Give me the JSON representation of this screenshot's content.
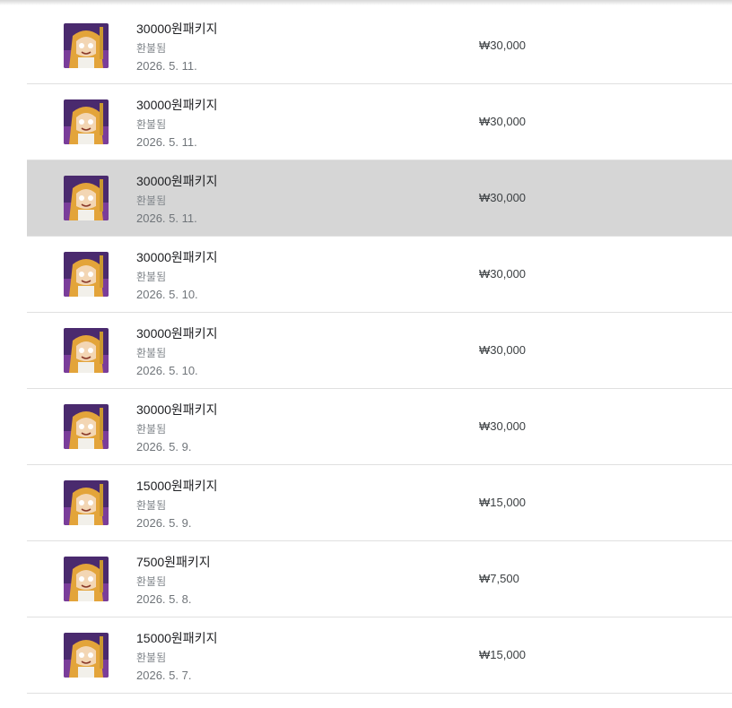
{
  "colors": {
    "selected_row": "#d6d6d6",
    "divider": "#e0e0e0",
    "title": "#202124",
    "secondary": "#80868b"
  },
  "purchases": [
    {
      "title": "30000원패키지",
      "status": "환불됨",
      "date": "2026. 5. 11.",
      "price": "₩30,000",
      "icon": "game-app-icon",
      "selected": false
    },
    {
      "title": "30000원패키지",
      "status": "환불됨",
      "date": "2026. 5. 11.",
      "price": "₩30,000",
      "icon": "game-app-icon",
      "selected": false
    },
    {
      "title": "30000원패키지",
      "status": "환불됨",
      "date": "2026. 5. 11.",
      "price": "₩30,000",
      "icon": "game-app-icon",
      "selected": true
    },
    {
      "title": "30000원패키지",
      "status": "환불됨",
      "date": "2026. 5. 10.",
      "price": "₩30,000",
      "icon": "game-app-icon",
      "selected": false
    },
    {
      "title": "30000원패키지",
      "status": "환불됨",
      "date": "2026. 5. 10.",
      "price": "₩30,000",
      "icon": "game-app-icon",
      "selected": false
    },
    {
      "title": "30000원패키지",
      "status": "환불됨",
      "date": "2026. 5. 9.",
      "price": "₩30,000",
      "icon": "game-app-icon",
      "selected": false
    },
    {
      "title": "15000원패키지",
      "status": "환불됨",
      "date": "2026. 5. 9.",
      "price": "₩15,000",
      "icon": "game-app-icon",
      "selected": false
    },
    {
      "title": "7500원패키지",
      "status": "환불됨",
      "date": "2026. 5. 8.",
      "price": "₩7,500",
      "icon": "game-app-icon",
      "selected": false
    },
    {
      "title": "15000원패키지",
      "status": "환불됨",
      "date": "2026. 5. 7.",
      "price": "₩15,000",
      "icon": "game-app-icon",
      "selected": false
    }
  ]
}
